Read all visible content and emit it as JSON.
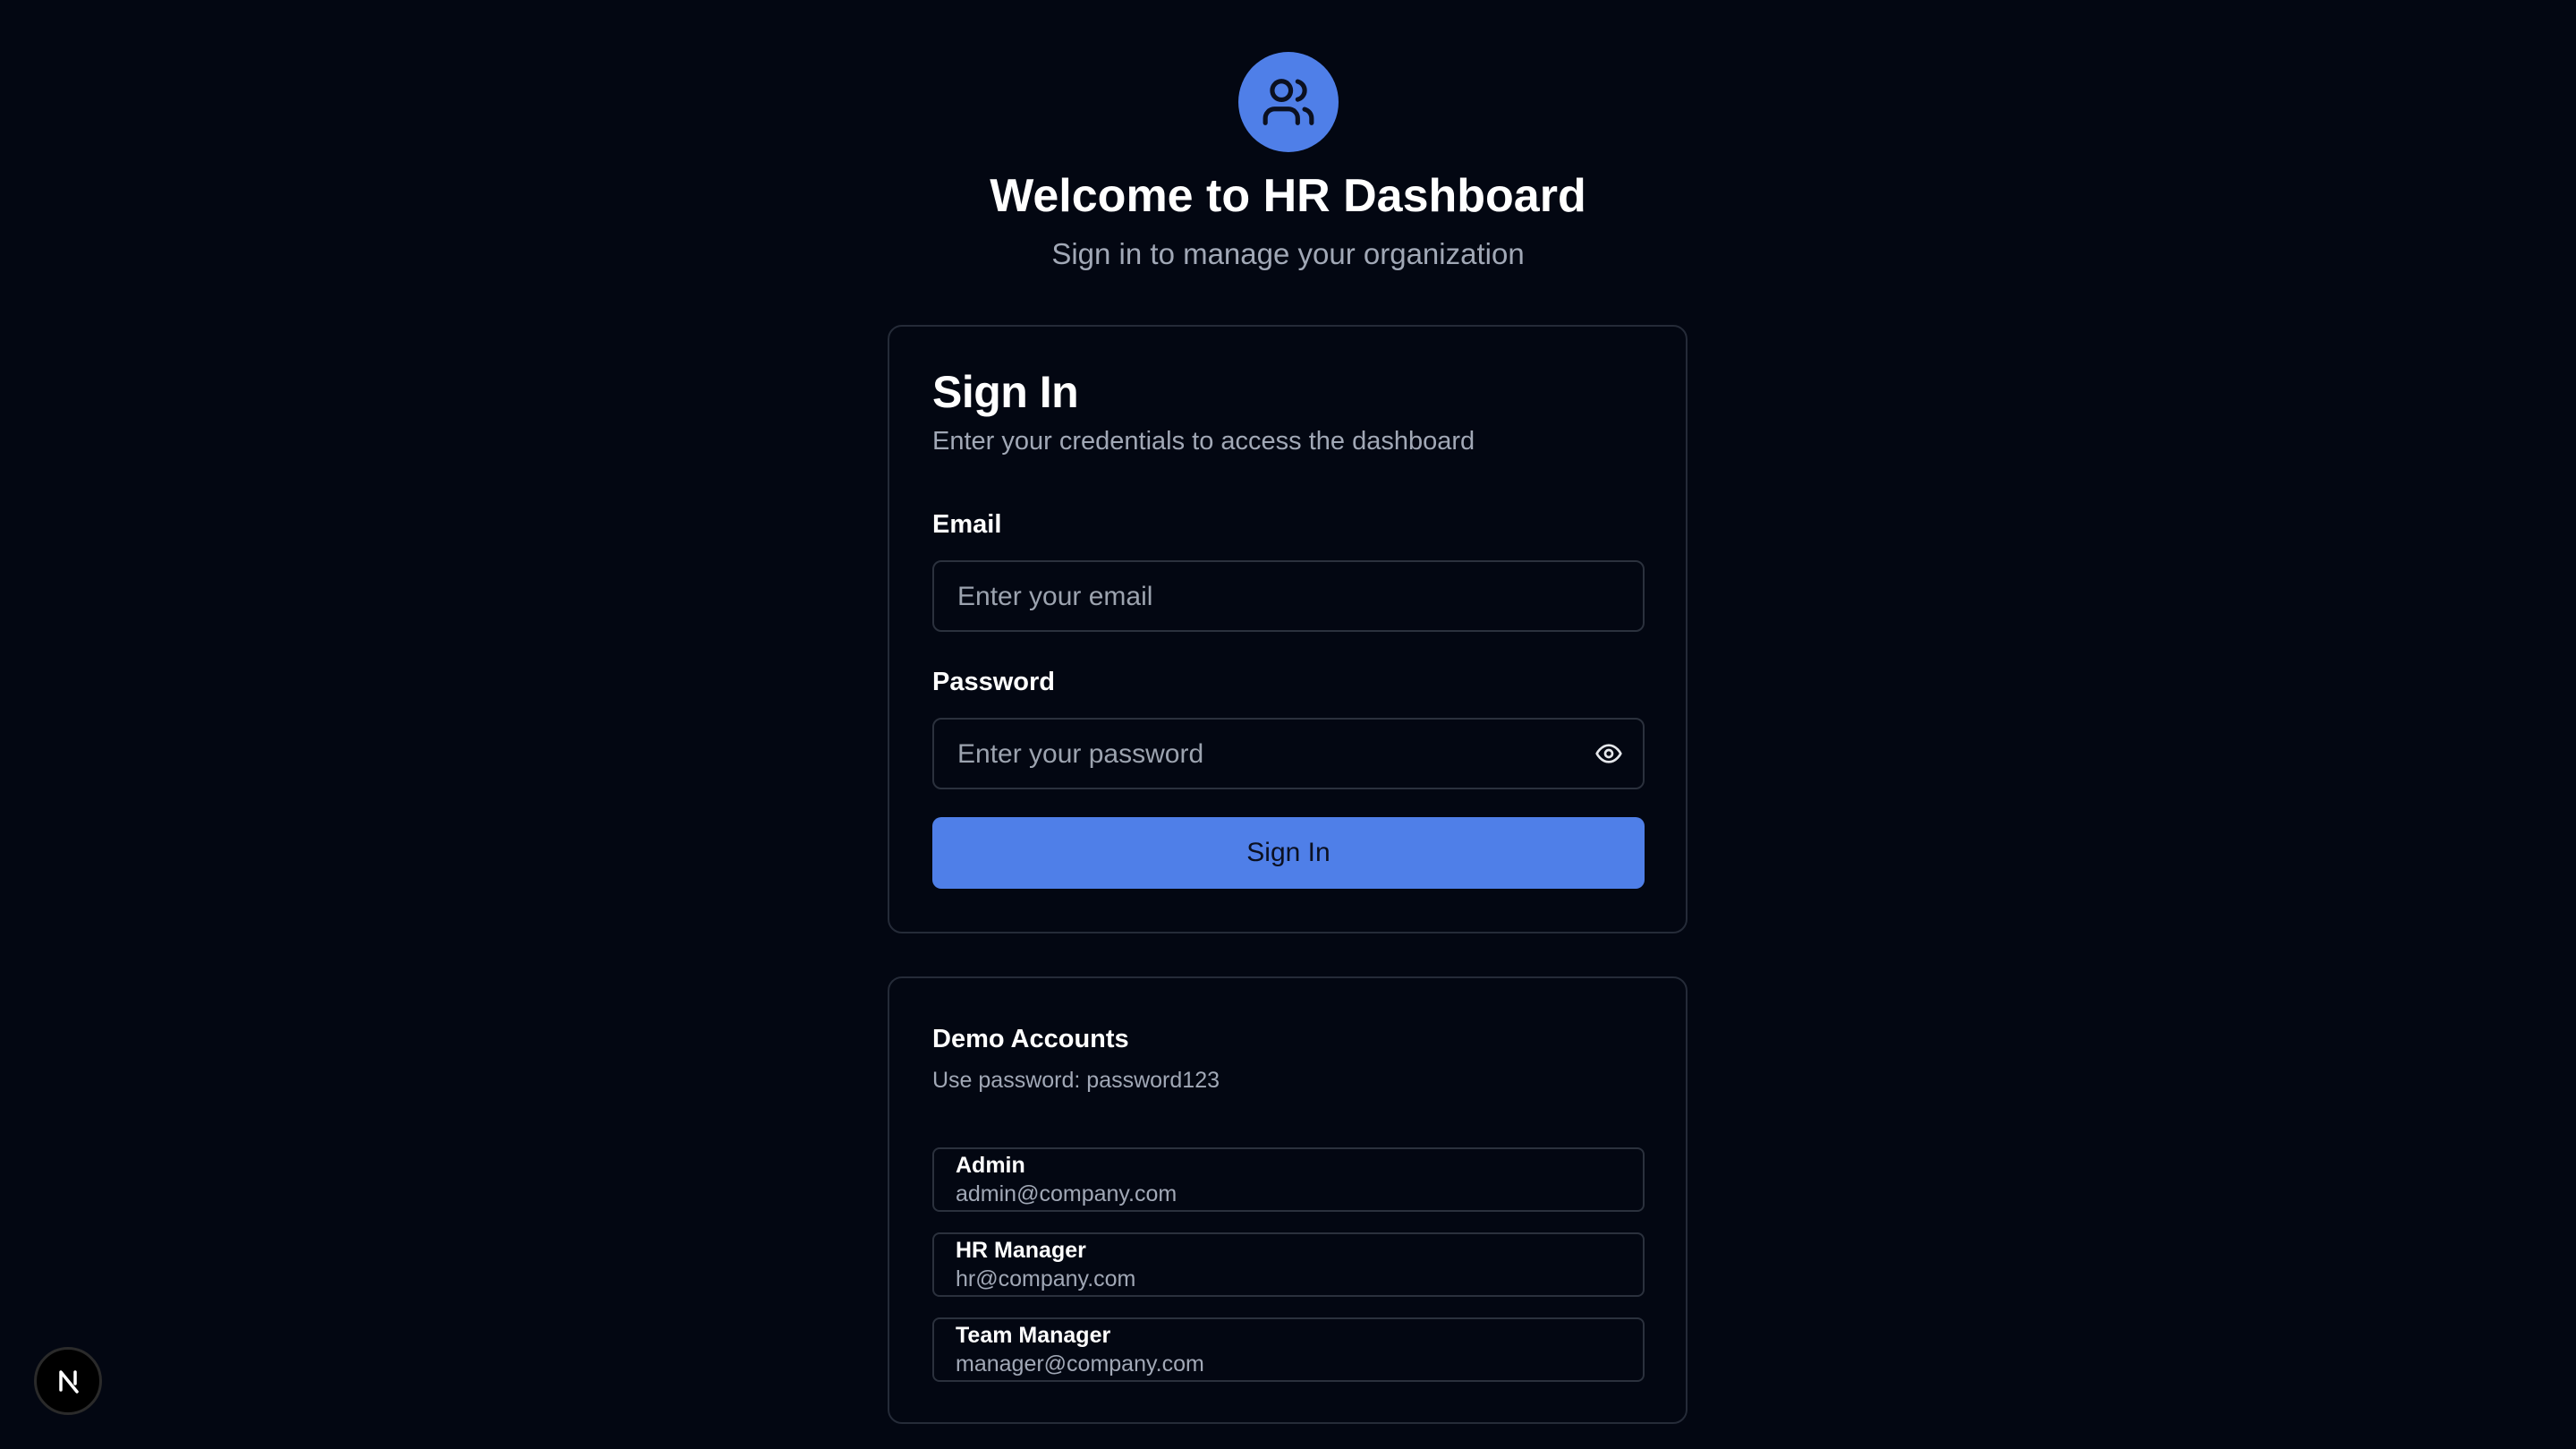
{
  "header": {
    "logo_icon": "users-icon",
    "title": "Welcome to HR Dashboard",
    "subtitle": "Sign in to manage your organization"
  },
  "signin": {
    "title": "Sign In",
    "description": "Enter your credentials to access the dashboard",
    "email_label": "Email",
    "email_placeholder": "Enter your email",
    "email_value": "",
    "password_label": "Password",
    "password_placeholder": "Enter your password",
    "password_value": "",
    "toggle_icon": "eye-icon",
    "submit_label": "Sign In"
  },
  "demo": {
    "title": "Demo Accounts",
    "hint": "Use password: password123",
    "accounts": [
      {
        "role": "Admin",
        "email": "admin@company.com"
      },
      {
        "role": "HR Manager",
        "email": "hr@company.com"
      },
      {
        "role": "Team Manager",
        "email": "manager@company.com"
      }
    ]
  },
  "badge": {
    "icon": "nextjs-logo-icon"
  },
  "colors": {
    "background": "#030712",
    "accent": "#4f7fe8",
    "border": "#2b313d",
    "muted_text": "#a1a8b6"
  }
}
